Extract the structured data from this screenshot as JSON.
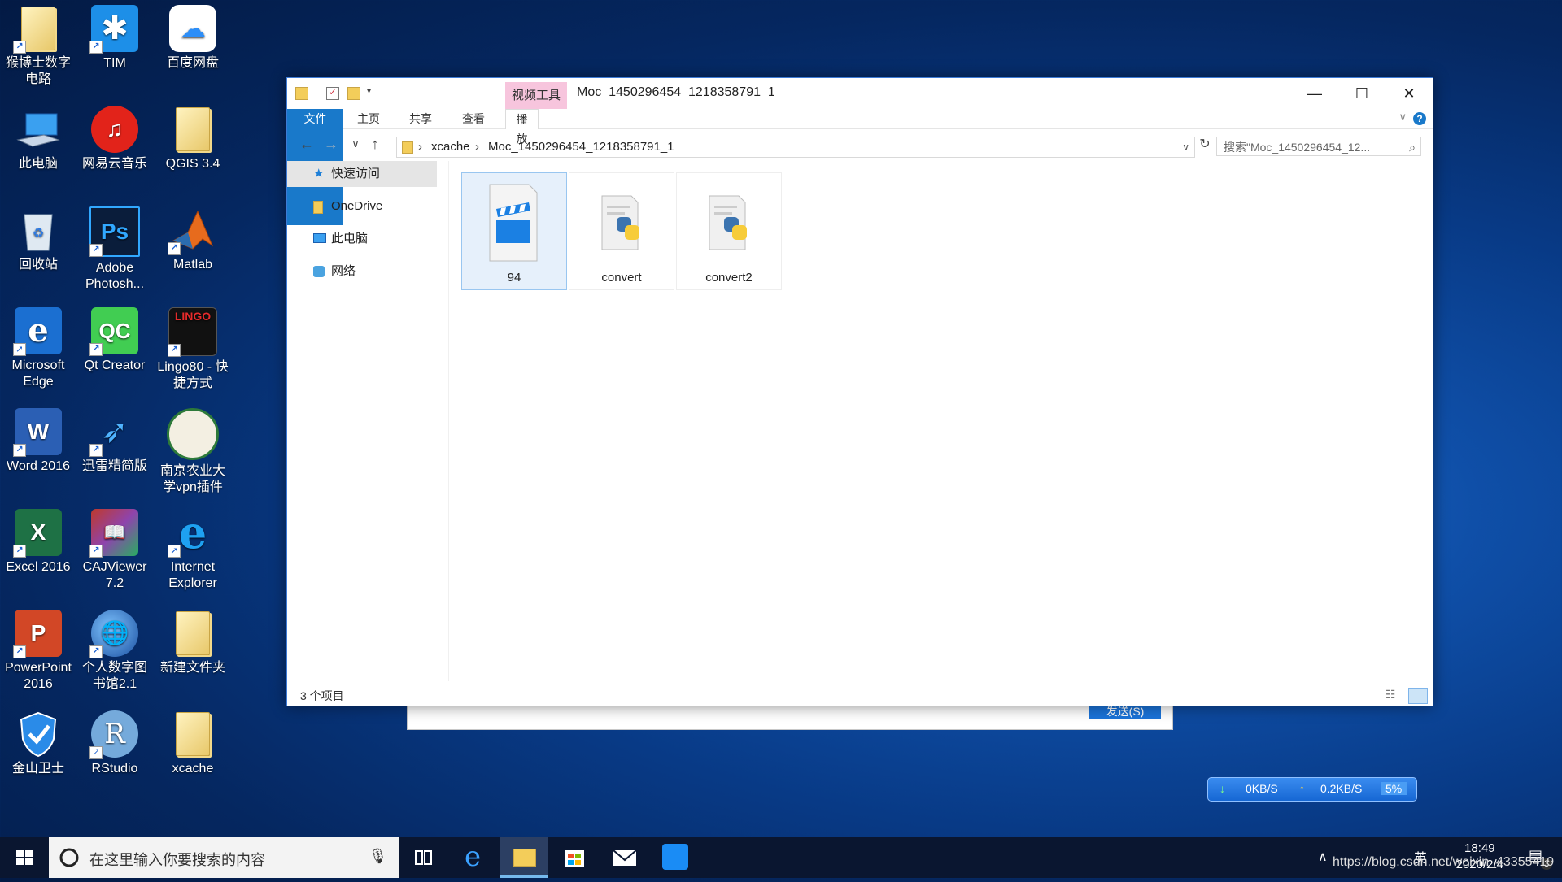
{
  "desktop": {
    "icons": [
      {
        "label": "猴博士数字电路"
      },
      {
        "label": "TIM"
      },
      {
        "label": "百度网盘"
      },
      {
        "label": "此电脑"
      },
      {
        "label": "网易云音乐"
      },
      {
        "label": "QGIS 3.4"
      },
      {
        "label": "回收站"
      },
      {
        "label": "Adobe Photosh..."
      },
      {
        "label": "Matlab"
      },
      {
        "label": "Microsoft Edge"
      },
      {
        "label": "Qt Creator"
      },
      {
        "label": "Lingo80 - 快捷方式"
      },
      {
        "label": "Word 2016"
      },
      {
        "label": "迅雷精简版"
      },
      {
        "label": "南京农业大学vpn插件"
      },
      {
        "label": "Excel 2016"
      },
      {
        "label": "CAJViewer 7.2"
      },
      {
        "label": "Internet Explorer"
      },
      {
        "label": "PowerPoint 2016"
      },
      {
        "label": "个人数字图书馆2.1"
      },
      {
        "label": "新建文件夹"
      },
      {
        "label": "金山卫士"
      },
      {
        "label": "RStudio"
      },
      {
        "label": "xcache"
      }
    ]
  },
  "explorer": {
    "tool_tab": "视频工具",
    "title": "Moc_1450296454_1218358791_1",
    "controls": {
      "minimize": "—",
      "maximize": "☐",
      "close": "✕"
    },
    "ribbon_tabs": [
      "文件",
      "主页",
      "共享",
      "查看",
      "播放"
    ],
    "address": {
      "crumbs": [
        "xcache",
        "Moc_1450296454_1218358791_1"
      ]
    },
    "search_placeholder": "搜索\"Moc_1450296454_12...",
    "nav": [
      "快速访问",
      "OneDrive",
      "此电脑",
      "网络"
    ],
    "files": [
      {
        "name": "94",
        "type": "video"
      },
      {
        "name": "convert",
        "type": "python"
      },
      {
        "name": "convert2",
        "type": "python"
      }
    ],
    "status": "3 个项目"
  },
  "dialog": {
    "send_label": "发送(S)"
  },
  "net_widget": {
    "down": "0KB/S",
    "up": "0.2KB/S",
    "cpu": "5%"
  },
  "taskbar": {
    "search_placeholder": "在这里输入你要搜索的内容",
    "time": "18:49",
    "date": "2020/2/4",
    "ime": "英",
    "watermark": "https://blog.csdn.net/weixin_43355419",
    "notification_count": "3"
  },
  "colors": {
    "accent": "#1979ca",
    "tool_tab": "#f7c5dd",
    "taskbar": "#0a1630"
  }
}
